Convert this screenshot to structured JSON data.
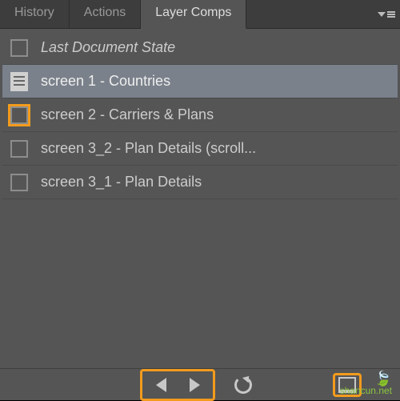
{
  "tabs": {
    "history": "History",
    "actions": "Actions",
    "layerComps": "Layer Comps"
  },
  "rows": {
    "lastState": "Last Document State",
    "screen1": "screen 1 - Countries",
    "screen2": "screen 2 - Carriers & Plans",
    "screen3_2": "screen 3_2 - Plan Details (scroll...",
    "screen3_1": "screen 3_1 - Plan Details"
  },
  "watermark": {
    "label": "shancun",
    "domain": ".net"
  }
}
